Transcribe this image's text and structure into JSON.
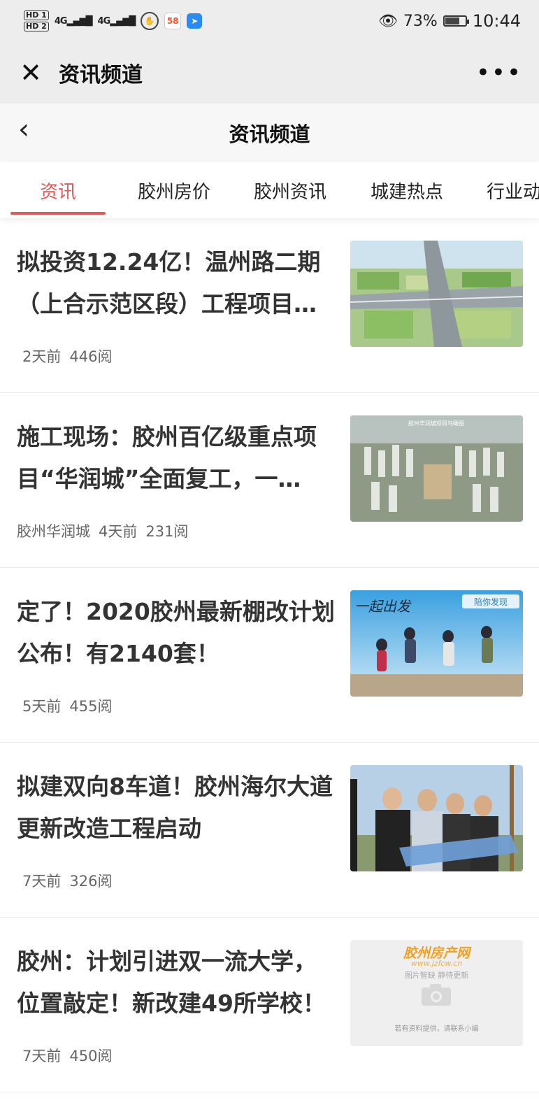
{
  "status_bar": {
    "hd1": "HD 1",
    "hd2": "HD 2",
    "signal1": "4G",
    "signal2": "4G",
    "app_58": "58",
    "battery": "73%",
    "time": "10:44",
    "battery_level": 0.73
  },
  "wx_header": {
    "title": "资讯频道"
  },
  "page_nav": {
    "title": "资讯频道"
  },
  "tabs": [
    {
      "label": "资讯",
      "active": true
    },
    {
      "label": "胶州房价"
    },
    {
      "label": "胶州资讯"
    },
    {
      "label": "城建热点"
    },
    {
      "label": "行业动"
    }
  ],
  "articles": [
    {
      "title": "拟投资12.24亿！温州路二期（上合示范区段）工程项目…",
      "source": "",
      "time": "2天前",
      "reads": "446阅"
    },
    {
      "title": "施工现场：胶州百亿级重点项目“华润城”全面复工，一…",
      "source": "胶州华润城",
      "time": "4天前",
      "reads": "231阅",
      "image_caption": "胶州华润城项目鸟瞰图"
    },
    {
      "title": "定了！2020胶州最新棚改计划公布！有2140套！",
      "source": "",
      "time": "5天前",
      "reads": "455阅",
      "image_text": "一起出发",
      "image_tag": "陪你发现"
    },
    {
      "title": "拟建双向8车道！胶州海尔大道更新改造工程启动",
      "source": "",
      "time": "7天前",
      "reads": "326阅"
    },
    {
      "title": "胶州：计划引进双一流大学，位置敲定！新改建49所学校！",
      "source": "",
      "time": "7天前",
      "reads": "450阅",
      "placeholder": {
        "brand": "胶州房产网",
        "url": "www.jzfcw.cn",
        "slogan": "图片智缺 静待更新",
        "note": "若有资料提供，请联系小编"
      }
    }
  ]
}
